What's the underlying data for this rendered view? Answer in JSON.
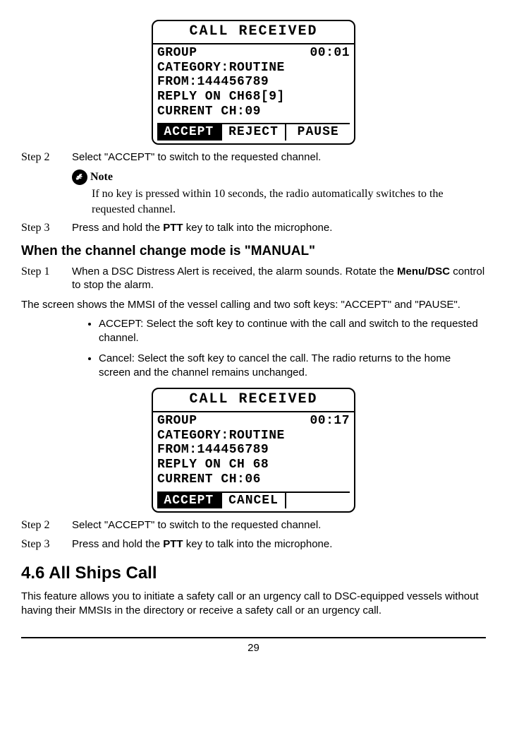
{
  "screen1": {
    "title": "CALL RECEIVED",
    "group_label": "GROUP",
    "time": "00:01",
    "category": "CATEGORY:ROUTINE",
    "from": "FROM:144456789",
    "reply": "REPLY ON CH68[9]",
    "current": "CURRENT CH:09",
    "sk1": "ACCEPT",
    "sk2": "REJECT",
    "sk3": "PAUSE"
  },
  "auto": {
    "step2_label": "Step 2",
    "step2_text": "Select \"ACCEPT\" to switch to the requested channel.",
    "note_label": "Note",
    "note_body": "If no key is pressed within 10 seconds, the radio automatically switches to the requested channel.",
    "step3_label": "Step 3",
    "step3_text_pre": "Press and hold the ",
    "step3_bold": "PTT",
    "step3_text_post": " key to talk into the microphone."
  },
  "manual_heading": "When the channel change mode is \"MANUAL\"",
  "manual": {
    "step1_label": "Step 1",
    "step1_text_pre": "When a DSC Distress Alert is received, the alarm sounds. Rotate the ",
    "step1_bold": "Menu/DSC",
    "step1_text_post": " control to stop the alarm.",
    "step1_para2": "The screen shows the MMSI of the vessel calling and two soft keys: \"ACCEPT\" and \"PAUSE\".",
    "bullet1": "ACCEPT: Select the soft key to continue with the call and switch to the requested channel.",
    "bullet2": "Cancel: Select the soft key to cancel the call. The radio returns to the home screen and the channel remains unchanged."
  },
  "screen2": {
    "title": "CALL RECEIVED",
    "group_label": "GROUP",
    "time": "00:17",
    "category": "CATEGORY:ROUTINE",
    "from": "FROM:144456789",
    "reply": "REPLY ON CH 68",
    "current": "CURRENT CH:06",
    "sk1": "ACCEPT",
    "sk2": "CANCEL"
  },
  "manual2": {
    "step2_label": "Step 2",
    "step2_text": "Select \"ACCEPT\" to switch to the requested channel.",
    "step3_label": "Step 3",
    "step3_text_pre": "Press and hold the ",
    "step3_bold": "PTT",
    "step3_text_post": " key to talk into the microphone."
  },
  "section_heading": "4.6 All Ships Call",
  "section_body": "This feature allows you to initiate a safety call or an urgency call to DSC-equipped vessels without having their MMSIs in the directory or receive a safety call or an urgency call.",
  "page_number": "29"
}
